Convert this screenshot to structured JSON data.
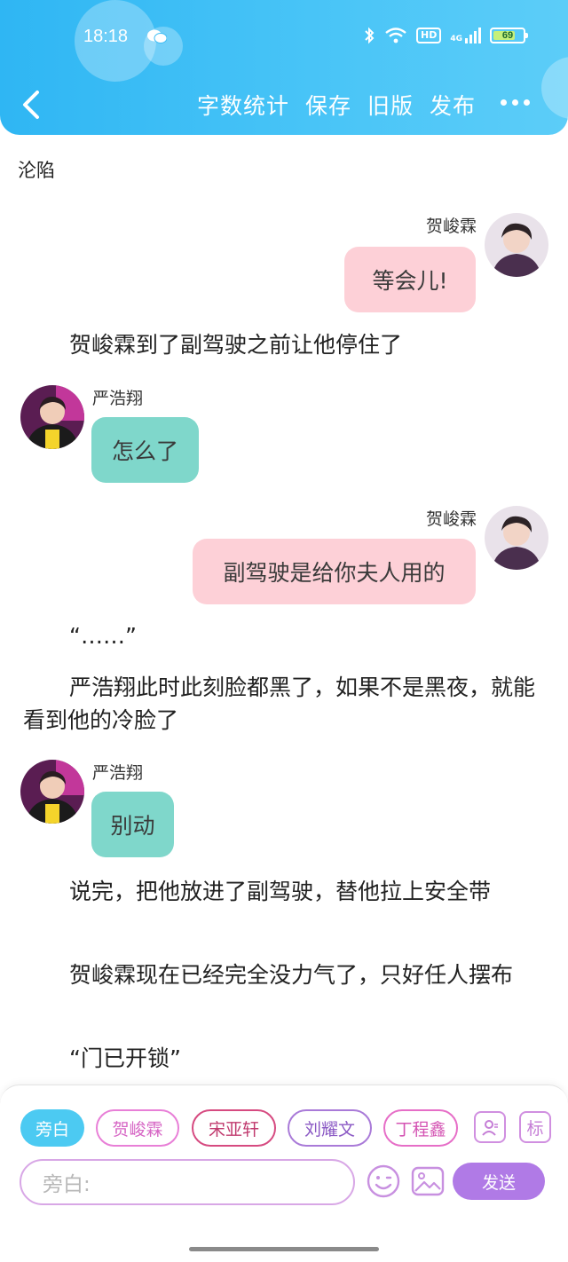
{
  "status_bar": {
    "time": "18:18",
    "hd": "HD",
    "network": "4G",
    "battery": "69"
  },
  "colors": {
    "header": "#2fb6f3",
    "pink_bubble": "#fdd0d7",
    "teal_bubble": "#7fd7cb",
    "send": "#b07ae6"
  },
  "nav": {
    "back_icon": "chevron-left-icon",
    "actions": [
      "字数统计",
      "保存",
      "旧版",
      "发布"
    ],
    "more_icon": "more-dots-icon"
  },
  "story_title": "沦陷",
  "messages": [
    {
      "speaker": "贺峻霖",
      "text": "等会儿!",
      "side": "right"
    },
    {
      "speaker": "严浩翔",
      "text": "怎么了",
      "side": "left"
    },
    {
      "speaker": "贺峻霖",
      "text": "副驾驶是给你夫人用的",
      "side": "right"
    },
    {
      "speaker": "严浩翔",
      "text": "别动",
      "side": "left"
    }
  ],
  "narration": [
    "贺峻霖到了副驾驶之前让他停住了",
    "“……”",
    "严浩翔此时此刻脸都黑了，如果不是黑夜，就能看到他的冷脸了",
    "说完，把他放进了副驾驶，替他拉上安全带",
    "贺峻霖现在已经完全没力气了，只好任人摆布",
    "“门已开锁”"
  ],
  "composer": {
    "role_chips": [
      "旁白",
      "贺峻霖",
      "宋亚轩",
      "刘耀文",
      "丁程鑫"
    ],
    "tag_button": "标",
    "input_placeholder": "旁白:",
    "send_label": "发送"
  }
}
